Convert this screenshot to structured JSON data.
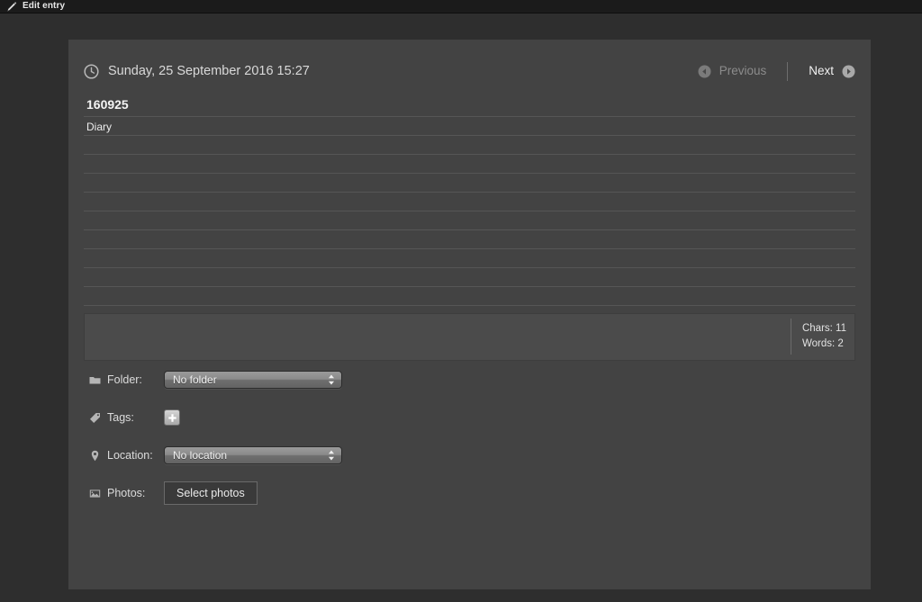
{
  "menubar": {
    "app_icon": "pencil-icon",
    "title": "Edit entry"
  },
  "entry": {
    "clock_icon": "clock-icon",
    "datetime": "Sunday, 25 September 2016 15:27",
    "nav": {
      "previous_label": "Previous",
      "previous_icon": "arrow-left-circle-icon",
      "previous_enabled": false,
      "next_label": "Next",
      "next_icon": "arrow-right-circle-icon",
      "next_enabled": true
    },
    "title_value": "160925",
    "title_placeholder": "Title",
    "body_value": "Diary",
    "body_placeholder": "",
    "stats": {
      "chars": "Chars: 11",
      "words": "Words: 2"
    },
    "meta": {
      "folder": {
        "icon": "folder-icon",
        "label": "Folder:",
        "value": "No folder"
      },
      "tags": {
        "icon": "tag-icon",
        "label": "Tags:",
        "add_button_icon": "plus-icon"
      },
      "location": {
        "icon": "map-pin-icon",
        "label": "Location:",
        "value": "No location"
      },
      "photos": {
        "icon": "photo-icon",
        "label": "Photos:",
        "button_label": "Select photos"
      }
    }
  },
  "colors": {
    "menubar_bg": "#1b1b1b",
    "desktop_bg": "#2e2e2e",
    "panel_bg": "#434343",
    "stats_bg": "#4b4b4b",
    "rule_line": "#565656",
    "text_primary": "#ededed",
    "text_dim": "#8c8c8c"
  }
}
